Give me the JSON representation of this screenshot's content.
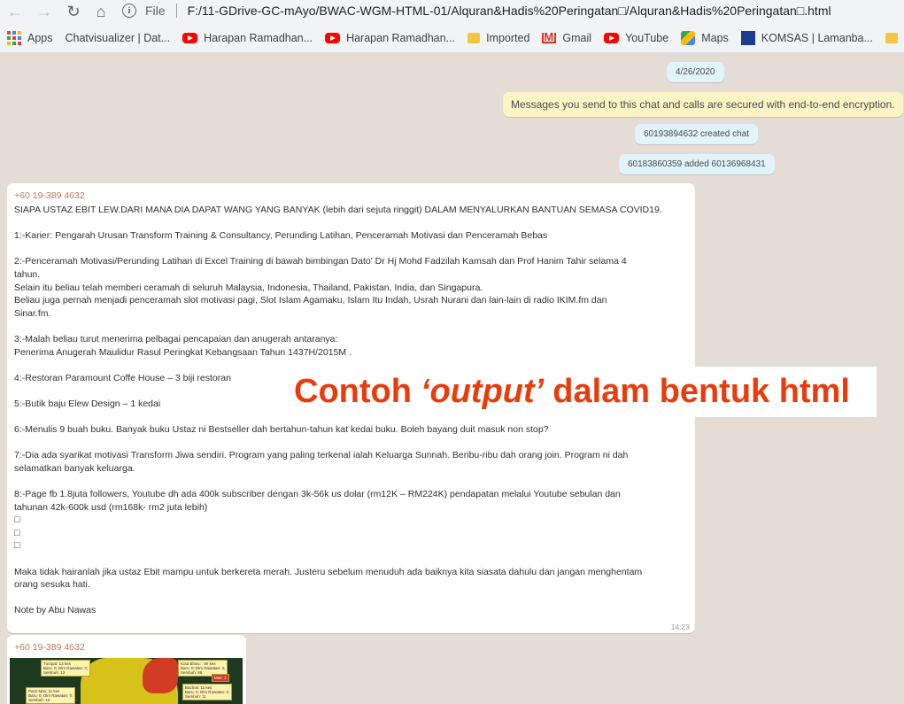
{
  "browser": {
    "scheme": "File",
    "url": "F:/11-GDrive-GC-mAyo/BWAC-WGM-HTML-01/Alquran&Hadis%20Peringatan□/Alquran&Hadis%20Peringatan□.html",
    "bookmarks": [
      {
        "label": "Apps",
        "icon": "apps-grid-icon"
      },
      {
        "label": "Chatvisualizer | Dat...",
        "icon": "chatvisualizer-icon"
      },
      {
        "label": "Harapan Ramadhan...",
        "icon": "youtube-icon"
      },
      {
        "label": "Harapan Ramadhan...",
        "icon": "youtube-icon"
      },
      {
        "label": "Imported",
        "icon": "folder-icon"
      },
      {
        "label": "Gmail",
        "icon": "gmail-icon"
      },
      {
        "label": "YouTube",
        "icon": "youtube-icon"
      },
      {
        "label": "Maps",
        "icon": "maps-icon"
      },
      {
        "label": "KOMSAS | Lamanba...",
        "icon": "komsas-icon"
      }
    ]
  },
  "chat": {
    "date": "4/26/2020",
    "encryption_notice": "Messages you send to this chat and calls are secured with end-to-end encryption.",
    "created": "60193894632 created chat",
    "added": "60183860359 added 60136968431",
    "messages": [
      {
        "sender": "+60 19-389 4632",
        "text": "SIAPA USTAZ EBIT LEW.DARI MANA DIA DAPAT WANG YANG BANYAK (lebih dari sejuta ringgit) DALAM MENYALURKAN BANTUAN SEMASA COVID19.\n\n1:-Karier: Pengarah Urusan Transform Training & Consultancy, Perunding Latihan, Penceramah Motivasi dan Penceramah Bebas\n\n2:-Penceramah Motivasi/Perunding Latihan di Excel Training di bawah bimbingan Dato' Dr Hj Mohd Fadzilah Kamsah dan Prof Hanim Tahir selama 4\ntahun.\nSelain itu beliau telah memberi ceramah di seluruh Malaysia, Indonesia, Thailand, Pakistan, India, dan Singapura.\nBeliau juga pernah menjadi penceramah slot motivasi pagi, Slot Islam Agamaku, Islam Itu Indah, Usrah Nurani dan lain-lain di radio IKIM.fm dan\nSinar.fm.\n\n3:-Malah beliau turut menerima pelbagai pencapaian dan anugerah antaranya:\nPenerima Anugerah Maulidur Rasul Peringkat Kebangsaan Tahun 1437H/2015M .\n\n4:-Restoran Paramount Coffe House – 3 biji restoran\n\n5:-Butik baju Elew Design – 1 kedai\n\n6:-Menulis 9 buah buku. Banyak buku Ustaz ni Bestseller dah bertahun-tahun kat kedai buku. Boleh bayang duit masuk non stop?\n\n7:-Dia ada syarikat motivasi Transform Jiwa sendiri. Program yang paling terkenal ialah Keluarga Sunnah. Beribu-ribu dah orang join. Program ni dah\nselamatkan banyak keluarga.\n\n8:-Page fb 1.8juta followers, Youtube dh ada 400k subscriber dengan 3k-56k us dolar (rm12K – RM224K) pendapatan melalui Youtube sebulan dan\ntahunan 42k-600k usd (rm168k- rm2 juta lebih)\n□\n□\n□\n\nMaka tidak hairanlah jika ustaz Ebit mampu untuk berkereta merah. Justeru sebelum menuduh ada baiknya kita siasata dahulu dan jangan menghentam\norang sesuka hati.\n\nNote by Abu Nawas",
        "time": "14:23"
      },
      {
        "sender": "+60 19-389 4632"
      }
    ],
    "map_labels": {
      "tumpat": "Tumpat: 13 kes\nBaru: 0; Dlm Rawatan: 0;\nSembuh: 13",
      "kota_bharu": "Kota Bharu : 90 kes\nBaru: 0; Dlm Rawatan: 4;\nSembuh: 86",
      "pasir_mas": "Pasir Mas: 11 kes\nBaru: 0; Dlm Rawatan: 0;\nSembuh: 10",
      "bachok": "Bachok: 11 kes\nBaru: 0; Dlm Rawatan: 0;\nSembuh: 11",
      "mati": "Mati: 1"
    }
  },
  "overlay": {
    "part1": "Contoh",
    "part2": "‘output’",
    "part3": "dalam bentuk html"
  }
}
